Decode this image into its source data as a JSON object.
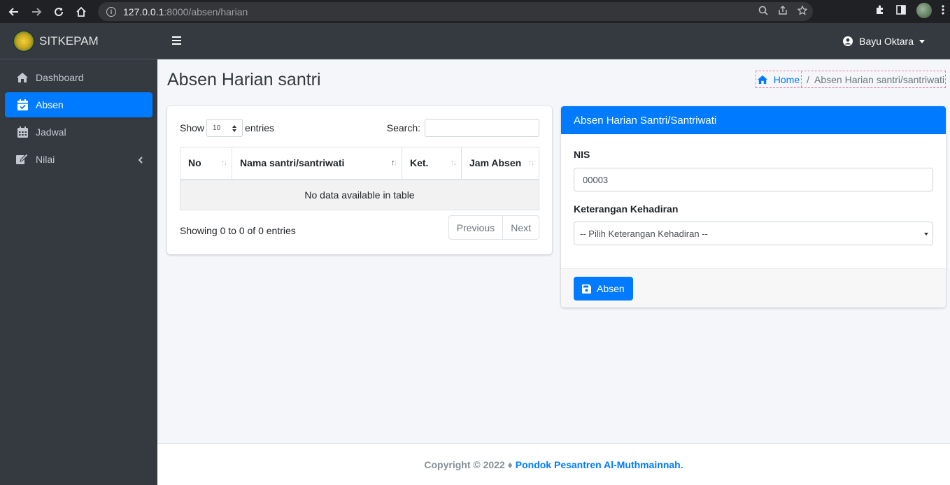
{
  "browser": {
    "url_host": "127.0.0.1",
    "url_rest": ":8000/absen/harian"
  },
  "brand": {
    "name": "SITKEPAM"
  },
  "sidebar": {
    "items": [
      {
        "label": "Dashboard",
        "icon": "home-icon",
        "active": false
      },
      {
        "label": "Absen",
        "icon": "calendar-check-icon",
        "active": true
      },
      {
        "label": "Jadwal",
        "icon": "calendar-icon",
        "active": false
      },
      {
        "label": "Nilai",
        "icon": "edit-icon",
        "active": false
      }
    ]
  },
  "navbar": {
    "user_name": "Bayu Oktara"
  },
  "page": {
    "title": "Absen Harian santri",
    "breadcrumb": {
      "home": "Home",
      "separator": "/",
      "current": "Absen Harian santri/santriwati"
    }
  },
  "table_card": {
    "show_label": "Show",
    "length_value": "10",
    "entries_label": "entries",
    "search_label": "Search:",
    "columns": [
      "No",
      "Nama santri/santriwati",
      "Ket.",
      "Jam Absen"
    ],
    "empty_text": "No data available in table",
    "info_text": "Showing 0 to 0 of 0 entries",
    "pagination": {
      "previous": "Previous",
      "next": "Next"
    }
  },
  "form_card": {
    "header": "Absen Harian Santri/Santriwati",
    "nis_label": "NIS",
    "nis_value": "00003",
    "keterangan_label": "Keterangan Kehadiran",
    "keterangan_selected": "-- Pilih Keterangan Kehadiran --",
    "submit_label": "Absen"
  },
  "footer": {
    "copyright": "Copyright © 2022 ♦",
    "org": "Pondok Pesantren Al-Muthmainnah."
  },
  "colors": {
    "primary": "#007bff",
    "sidebar_bg": "#343a40",
    "content_bg": "#f4f6f9"
  }
}
